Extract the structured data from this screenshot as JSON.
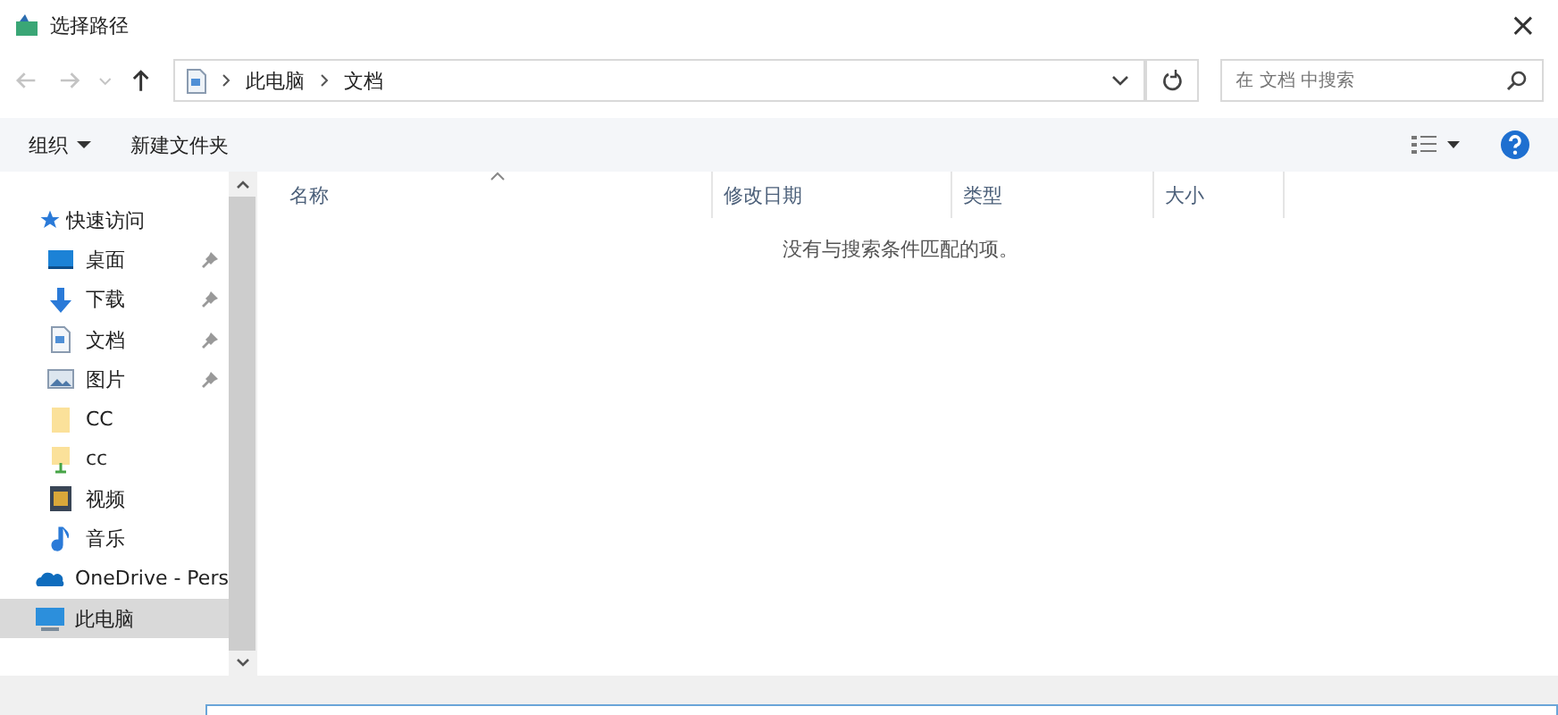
{
  "window": {
    "title": "选择路径",
    "close": "×"
  },
  "nav": {
    "path": [
      "此电脑",
      "文档"
    ],
    "search": {
      "placeholder": "在 文档 中搜索"
    }
  },
  "toolbar": {
    "organize": "组织",
    "new_folder": "新建文件夹"
  },
  "sidebar": {
    "items": [
      {
        "label": "快速访问",
        "kind": "star",
        "pinned": false,
        "selected": false
      },
      {
        "label": "桌面",
        "kind": "desktop",
        "pinned": true,
        "selected": false
      },
      {
        "label": "下载",
        "kind": "download",
        "pinned": true,
        "selected": false
      },
      {
        "label": "文档",
        "kind": "document",
        "pinned": true,
        "selected": false
      },
      {
        "label": "图片",
        "kind": "pictures",
        "pinned": true,
        "selected": false
      },
      {
        "label": "CC",
        "kind": "folder",
        "pinned": false,
        "selected": false
      },
      {
        "label": "cc",
        "kind": "folder-green",
        "pinned": false,
        "selected": false
      },
      {
        "label": "视频",
        "kind": "video",
        "pinned": false,
        "selected": false
      },
      {
        "label": "音乐",
        "kind": "music",
        "pinned": false,
        "selected": false
      },
      {
        "label": "OneDrive - Pers",
        "kind": "cloud",
        "pinned": false,
        "selected": false
      },
      {
        "label": "此电脑",
        "kind": "pc",
        "pinned": false,
        "selected": true
      }
    ]
  },
  "table": {
    "columns": [
      "名称",
      "修改日期",
      "类型",
      "大小"
    ],
    "empty_message": "没有与搜索条件匹配的项。"
  }
}
